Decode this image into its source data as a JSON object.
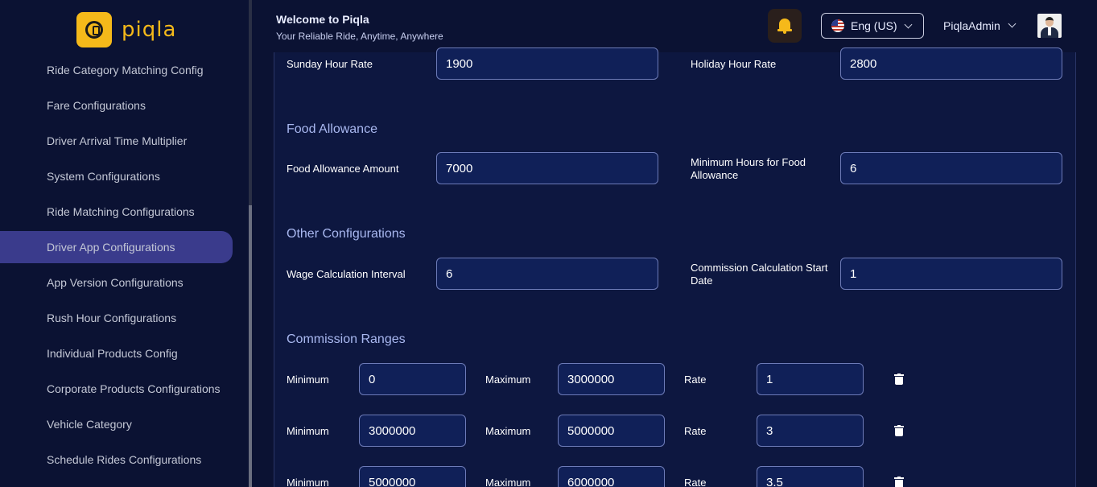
{
  "brand": {
    "name": "piqla"
  },
  "header": {
    "welcome": "Welcome to Piqla",
    "tagline": "Your Reliable Ride, Anytime, Anywhere",
    "language": "Eng (US)",
    "username": "PiqlaAdmin"
  },
  "sidebar": {
    "items": [
      {
        "label": "Ride Category Matching Config"
      },
      {
        "label": "Fare Configurations"
      },
      {
        "label": "Driver Arrival Time Multiplier"
      },
      {
        "label": "System Configurations"
      },
      {
        "label": "Ride Matching Configurations"
      },
      {
        "label": "Driver App Configurations",
        "active": true
      },
      {
        "label": "App Version Configurations"
      },
      {
        "label": "Rush Hour Configurations"
      },
      {
        "label": "Individual Products Config"
      },
      {
        "label": "Corporate Products Configurations"
      },
      {
        "label": "Vehicle Category"
      },
      {
        "label": "Schedule Rides Configurations"
      }
    ]
  },
  "form": {
    "sunday_hour_rate": {
      "label": "Sunday Hour Rate",
      "value": "1900"
    },
    "holiday_hour_rate": {
      "label": "Holiday Hour Rate",
      "value": "2800"
    },
    "food_section": "Food Allowance",
    "food_allowance_amount": {
      "label": "Food Allowance Amount",
      "value": "7000"
    },
    "min_hours_food": {
      "label": "Minimum Hours for Food Allowance",
      "value": "6"
    },
    "other_section": "Other Configurations",
    "wage_interval": {
      "label": "Wage Calculation Interval",
      "value": "6"
    },
    "commission_start": {
      "label": "Commission Calculation Start Date",
      "value": "1"
    },
    "commission_section": "Commission Ranges",
    "labels": {
      "minimum": "Minimum",
      "maximum": "Maximum",
      "rate": "Rate"
    },
    "ranges": [
      {
        "min": "0",
        "max": "3000000",
        "rate": "1"
      },
      {
        "min": "3000000",
        "max": "5000000",
        "rate": "3"
      },
      {
        "min": "5000000",
        "max": "6000000",
        "rate": "3.5"
      }
    ]
  },
  "colors": {
    "accent": "#f5b91a",
    "active_menu": "#3a3b8c",
    "background": "#0b1233"
  }
}
